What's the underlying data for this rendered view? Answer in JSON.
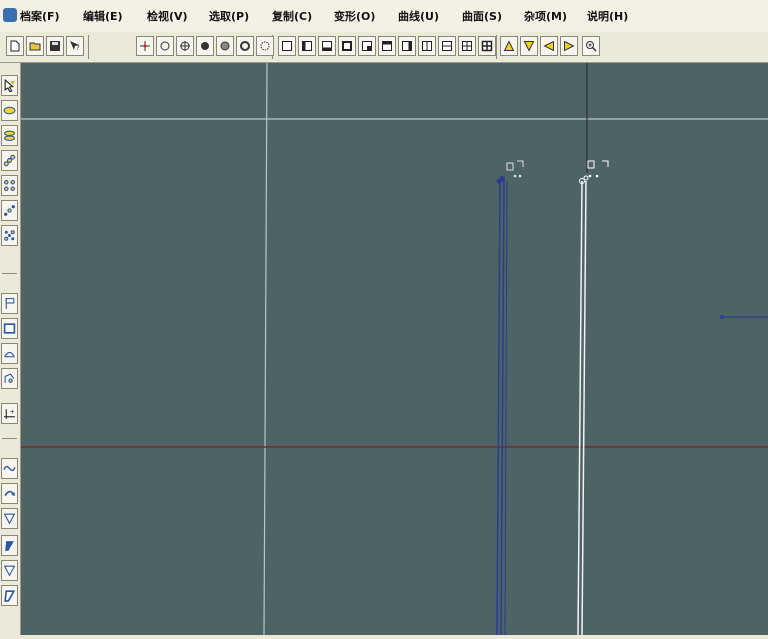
{
  "menu": [
    {
      "label": "档案(F)"
    },
    {
      "label": "编辑(E)"
    },
    {
      "label": "检视(V)"
    },
    {
      "label": "选取(P)"
    },
    {
      "label": "复制(C)"
    },
    {
      "label": "变形(O)"
    },
    {
      "label": "曲线(U)"
    },
    {
      "label": "曲面(S)"
    },
    {
      "label": "杂项(M)"
    },
    {
      "label": "说明(H)"
    }
  ],
  "toolbar_icons": [
    "new-file-icon",
    "open-file-icon",
    "save-file-icon",
    "help-icon",
    "point-icon",
    "circle-icon",
    "crosshair-circle-icon",
    "filled-circle-icon",
    "gray-circle-icon",
    "ring-icon",
    "dotted-circle-icon",
    "square-icon",
    "square-bottom-left-icon",
    "square-bottom-icon",
    "square-thick-icon",
    "square-bottom-right-icon",
    "square-top-icon",
    "square-right-icon",
    "split-vertical-icon",
    "split-horizontal-icon",
    "grid-four-icon",
    "grid-four-bold-icon",
    "triangle-up-icon",
    "triangle-down-icon",
    "triangle-left-icon",
    "triangle-right-icon",
    "zoom-icon"
  ],
  "left_icons": [
    "select-arrow-icon",
    "select-ellipse-icon",
    "select-oval-icon",
    "scatter-select-icon",
    "grid-dots-icon",
    "diagonal-dots-icon",
    "dot-grid-icon",
    "flag-icon",
    "rectangle-icon",
    "arc-icon",
    "curve-select-icon",
    "axis-plus-icon",
    "wave-icon",
    "arrow-curve-icon",
    "triangle-down-outline-icon",
    "slant-blue-icon",
    "triangle-fill-icon",
    "slant-blue-2-icon"
  ],
  "colors": {
    "viewport_bg": "#4d6365",
    "grid_line": "#b9c7c6",
    "axis_red": "#7a2a2a",
    "axis_dark": "#2b2f33",
    "curve_blue": "#2e3c8c",
    "curve_white": "#f2f2f2"
  }
}
